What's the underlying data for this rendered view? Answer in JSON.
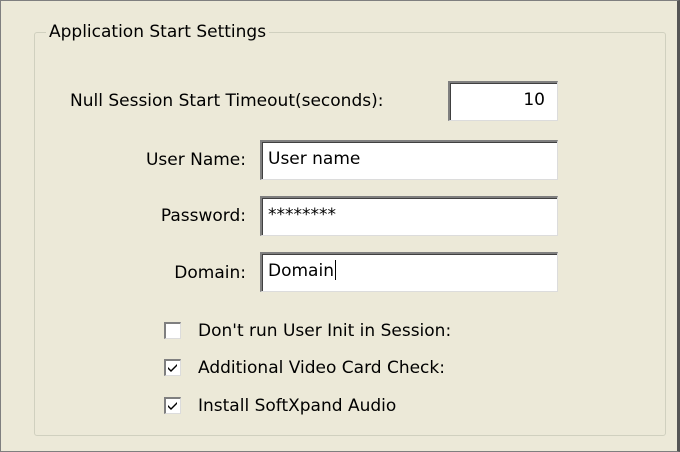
{
  "group": {
    "title": "Application Start Settings"
  },
  "fields": {
    "timeout": {
      "label": "Null Session Start Timeout(seconds):",
      "value": "10"
    },
    "username": {
      "label": "User Name:",
      "value": "User name"
    },
    "password": {
      "label": "Password:",
      "value": "********"
    },
    "domain": {
      "label": "Domain:",
      "value": "Domain"
    }
  },
  "checkboxes": [
    {
      "label": "Don't run User Init in Session:",
      "checked": false
    },
    {
      "label": "Additional Video Card Check:",
      "checked": true
    },
    {
      "label": "Install SoftXpand Audio",
      "checked": true
    }
  ],
  "colors": {
    "background": "#ece9d8",
    "input_background": "#ffffff",
    "group_border": "#d0d0bf"
  }
}
